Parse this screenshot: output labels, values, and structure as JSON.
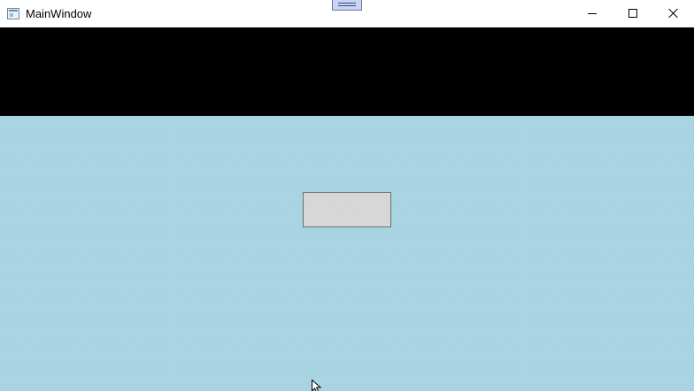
{
  "window": {
    "title": "MainWindow",
    "icon": "app-window-icon"
  },
  "titlebar_controls": {
    "grip_icon": "drag-grip-icon",
    "minimize_icon": "minimize-icon",
    "maximize_icon": "maximize-icon",
    "close_icon": "close-icon"
  },
  "colors": {
    "top_panel": "#000000",
    "content_background": "#add8e6",
    "button_background": "#dddddd",
    "button_border": "#707070"
  },
  "content": {
    "center_button_label": ""
  }
}
